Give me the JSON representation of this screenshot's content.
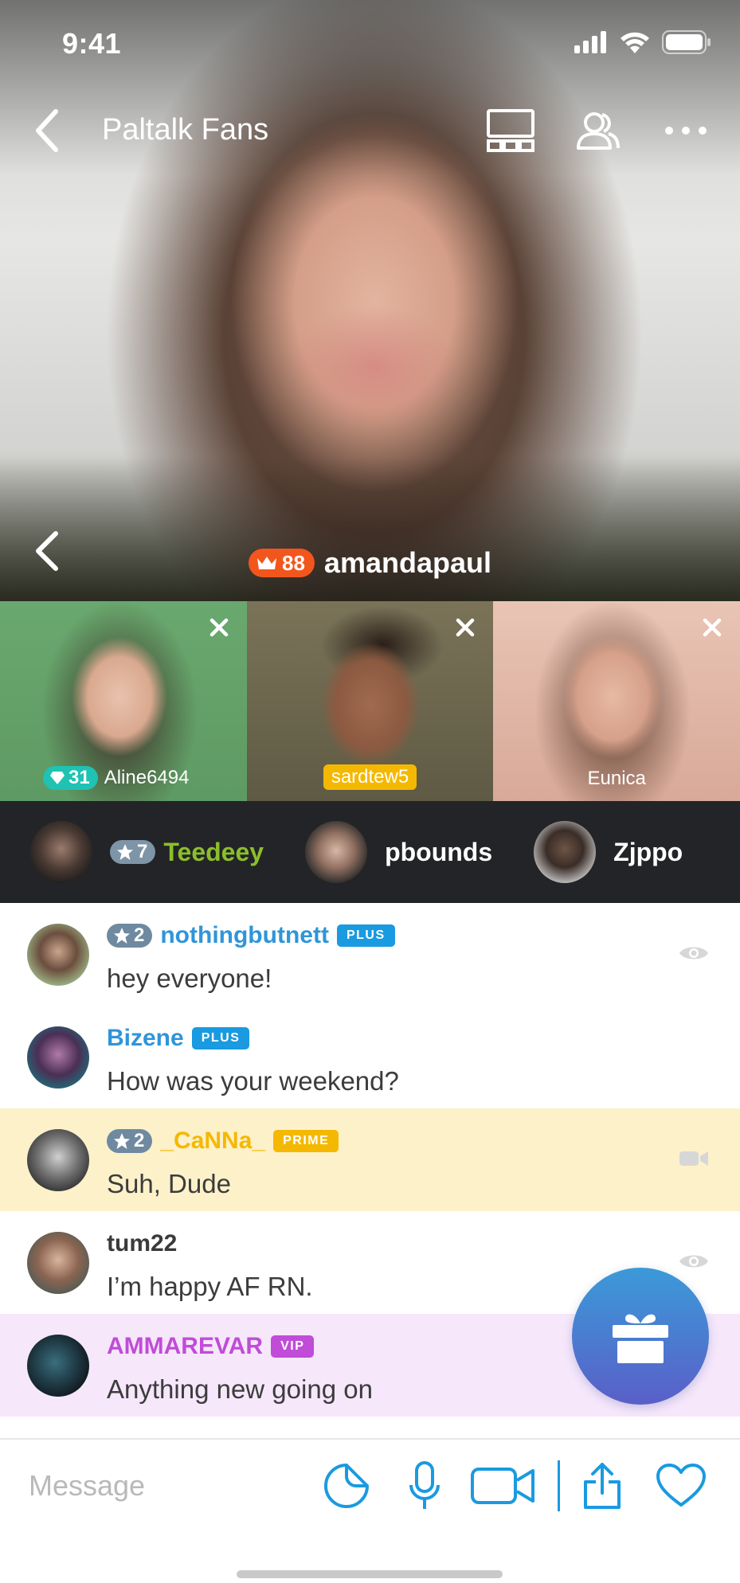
{
  "status_bar": {
    "time": "9:41"
  },
  "header": {
    "title": "Paltalk Fans"
  },
  "broadcaster": {
    "level": "88",
    "name": "amandapaul"
  },
  "cams": [
    {
      "name": "Aline6494",
      "gem_level": "31"
    },
    {
      "name": "sardtew5"
    },
    {
      "name": "Eunica"
    }
  ],
  "viewers": [
    {
      "name": "Teedeey",
      "star_level": "7"
    },
    {
      "name": "pbounds"
    },
    {
      "name": "Zjppo"
    }
  ],
  "messages": [
    {
      "user": "nothingbutnett",
      "star_level": "2",
      "tier": "PLUS",
      "text": "hey everyone!",
      "state": "eye-icon"
    },
    {
      "user": "Bizene",
      "tier": "PLUS",
      "text": "How was your weekend?"
    },
    {
      "user": "_CaNNa_",
      "star_level": "2",
      "tier": "PRIME",
      "text": "Suh, Dude",
      "state": "video-camera-icon"
    },
    {
      "user": "tum22",
      "text": "I’m happy AF RN.",
      "state": "eye-icon"
    },
    {
      "user": "AMMAREVAR",
      "tier": "VIP",
      "text": "Anything new going on"
    }
  ],
  "composer": {
    "placeholder": "Message"
  },
  "colors": {
    "accent": "#1a9ae0",
    "crown_badge": "#f2561d",
    "gem_badge": "#1fc2b3",
    "prime": "#f5b800",
    "vip": "#c04cd8",
    "teedeey": "#8bbf2a",
    "plus_user": "#2f95d8"
  }
}
